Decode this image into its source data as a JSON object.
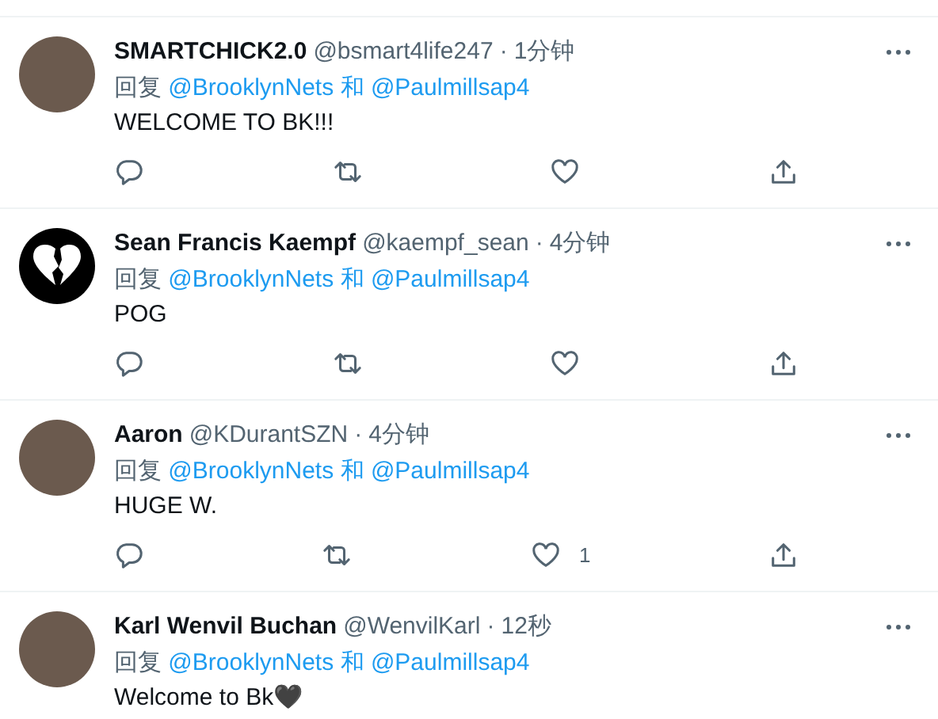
{
  "tweets": [
    {
      "name": "SMARTCHICK2.0",
      "handle": "@bsmart4life247",
      "time": "1分钟",
      "reply_prefix": "回复",
      "mentions": [
        "@BrooklynNets",
        "@Paulmillsap4"
      ],
      "joiner": "和",
      "text": "WELCOME TO BK!!!",
      "avatar": {
        "kind": "photo"
      },
      "separator": "·"
    },
    {
      "name": "Sean Francis Kaempf",
      "handle": "@kaempf_sean",
      "time": "4分钟",
      "reply_prefix": "回复",
      "mentions": [
        "@BrooklynNets",
        "@Paulmillsap4"
      ],
      "joiner": "和",
      "text": "POG",
      "avatar": {
        "kind": "logo"
      },
      "separator": "·"
    },
    {
      "name": "Aaron",
      "handle": "@KDurantSZN",
      "time": "4分钟",
      "reply_prefix": "回复",
      "mentions": [
        "@BrooklynNets",
        "@Paulmillsap4"
      ],
      "joiner": "和",
      "text": "HUGE W.",
      "avatar": {
        "kind": "photo"
      },
      "separator": "·",
      "like_count": "1"
    },
    {
      "name": "Karl Wenvil Buchan",
      "handle": "@WenvilKarl",
      "time": "12秒",
      "reply_prefix": "回复",
      "mentions": [
        "@BrooklynNets",
        "@Paulmillsap4"
      ],
      "joiner": "和",
      "text": "Welcome to Bk🖤",
      "avatar": {
        "kind": "photo"
      },
      "separator": "·"
    }
  ]
}
